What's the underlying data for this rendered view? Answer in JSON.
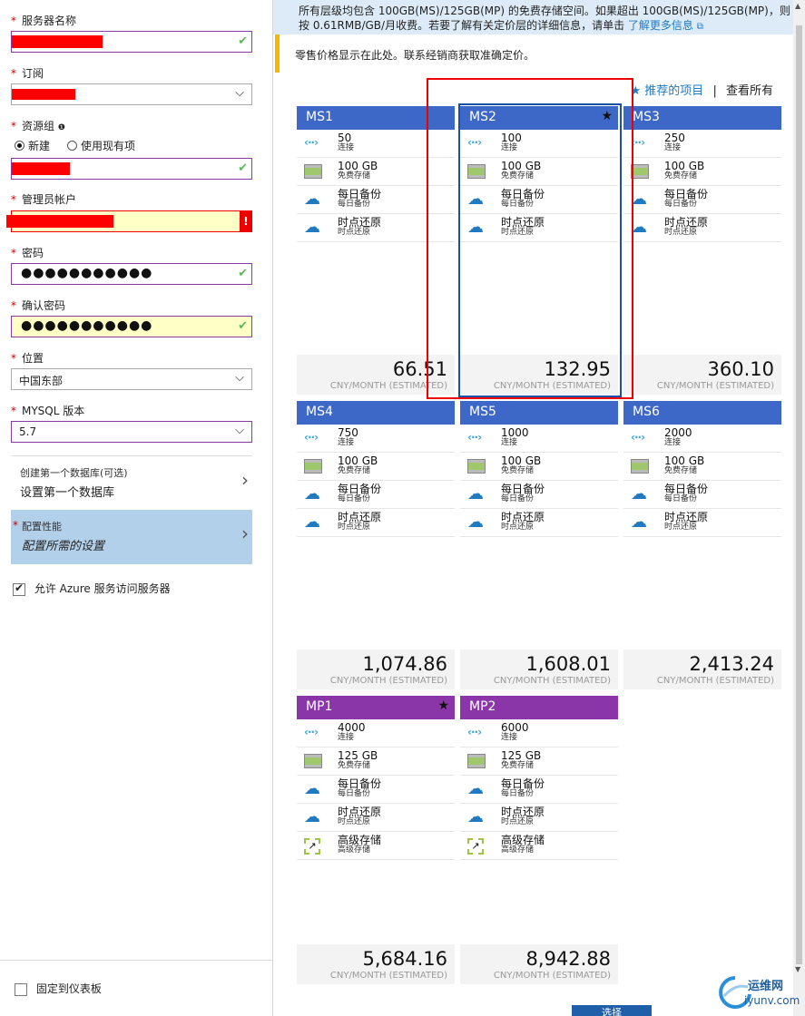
{
  "left": {
    "server_name": {
      "label": "服务器名称"
    },
    "subscription": {
      "label": "订阅"
    },
    "resource_group": {
      "label": "资源组",
      "radio_new": "新建",
      "radio_existing": "使用现有项"
    },
    "admin": {
      "label": "管理员帐户",
      "error_mark": "!"
    },
    "password": {
      "label": "密码",
      "value": "●●●●●●●●●●●"
    },
    "confirm_password": {
      "label": "确认密码",
      "value": "●●●●●●●●●●●"
    },
    "location": {
      "label": "位置",
      "value": "中国东部"
    },
    "mysql_version": {
      "label": "MYSQL 版本",
      "value": "5.7"
    },
    "create_db": {
      "small": "创建第一个数据库(可选)",
      "big": "设置第一个数据库"
    },
    "perf": {
      "small": "配置性能",
      "big": "配置所需的设置"
    },
    "allow_azure": "允许 Azure 服务访问服务器",
    "pin": "固定到仪表板",
    "required_mark": "*"
  },
  "right": {
    "info_line1": "所有层级均包含 100GB(MS)/125GB(MP) 的免费存储空间。如果超出 100GB(MS)/125GB(MP)，则",
    "info_line2": "按 0.61RMB/GB/月收费。若要了解有关定价层的详细信息，请单击",
    "info_link": "了解更多信息",
    "notice": "零售价格显示在此处。联系经销商获取准确定价。",
    "recommended": "推荐的项目",
    "separator": "|",
    "view_all": "查看所有",
    "select_button": "选择",
    "est_label": "CNY/MONTH (ESTIMATED)",
    "cards": [
      {
        "name": "MS1",
        "conn": "50",
        "conn_l": "连接",
        "storage": "100 GB",
        "storage_l": "免费存储",
        "backup": "每日备份",
        "backup_l": "每日备份",
        "restore": "时点还原",
        "restore_l": "时点还原",
        "price": "66.51"
      },
      {
        "name": "MS2",
        "star": "★",
        "conn": "100",
        "conn_l": "连接",
        "storage": "100 GB",
        "storage_l": "免费存储",
        "backup": "每日备份",
        "backup_l": "每日备份",
        "restore": "时点还原",
        "restore_l": "时点还原",
        "price": "132.95"
      },
      {
        "name": "MS3",
        "conn": "250",
        "conn_l": "连接",
        "storage": "100 GB",
        "storage_l": "免费存储",
        "backup": "每日备份",
        "backup_l": "每日备份",
        "restore": "时点还原",
        "restore_l": "时点还原",
        "price": "360.10"
      },
      {
        "name": "MS4",
        "conn": "750",
        "conn_l": "连接",
        "storage": "100 GB",
        "storage_l": "免费存储",
        "backup": "每日备份",
        "backup_l": "每日备份",
        "restore": "时点还原",
        "restore_l": "时点还原",
        "price": "1,074.86"
      },
      {
        "name": "MS5",
        "conn": "1000",
        "conn_l": "连接",
        "storage": "100 GB",
        "storage_l": "免费存储",
        "backup": "每日备份",
        "backup_l": "每日备份",
        "restore": "时点还原",
        "restore_l": "时点还原",
        "price": "1,608.01"
      },
      {
        "name": "MS6",
        "conn": "2000",
        "conn_l": "连接",
        "storage": "100 GB",
        "storage_l": "免费存储",
        "backup": "每日备份",
        "backup_l": "每日备份",
        "restore": "时点还原",
        "restore_l": "时点还原",
        "price": "2,413.24"
      },
      {
        "name": "MP1",
        "star": "★",
        "conn": "4000",
        "conn_l": "连接",
        "storage": "125 GB",
        "storage_l": "免费存储",
        "backup": "每日备份",
        "backup_l": "每日备份",
        "restore": "时点还原",
        "restore_l": "时点还原",
        "premium": "高级存储",
        "premium_l": "高级存储",
        "price": "5,684.16"
      },
      {
        "name": "MP2",
        "conn": "6000",
        "conn_l": "连接",
        "storage": "125 GB",
        "storage_l": "免费存储",
        "backup": "每日备份",
        "backup_l": "每日备份",
        "restore": "时点还原",
        "restore_l": "时点还原",
        "premium": "高级存储",
        "premium_l": "高级存储",
        "price": "8,942.88"
      }
    ]
  },
  "watermark": {
    "line1": "运维网",
    "line2": "iyunv.com"
  },
  "colors": {
    "ms_header": "#3e68c8",
    "mp_header": "#8a35a8",
    "accent": "#1f7ac2",
    "required": "#cc0000"
  }
}
